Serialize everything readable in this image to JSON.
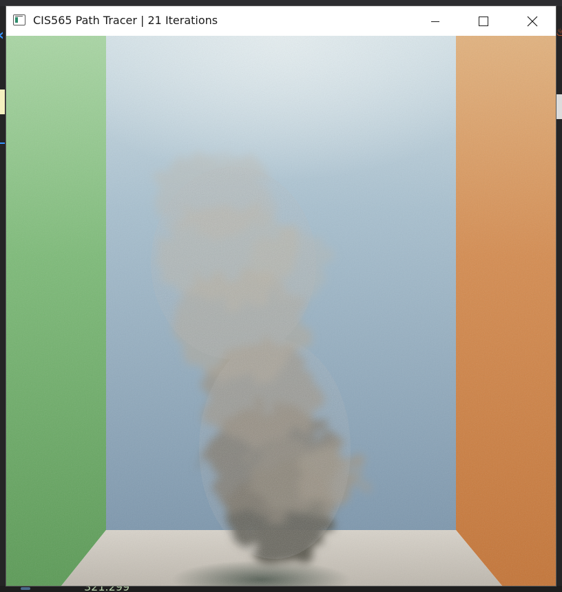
{
  "window": {
    "title": "CIS565 Path Tracer | 21 Iterations",
    "icon": "app-window-icon",
    "controls": [
      "minimize-icon",
      "maximize-icon",
      "close-icon"
    ]
  },
  "colors": {
    "left_wall": "#6aa86a",
    "right_wall": "#d68d4e",
    "back_wall": "#8fb0c6",
    "floor": "#cdc8c0",
    "smoke": "#9e9486",
    "titlebar": "#ffffff"
  },
  "background_editor": {
    "bottom_text": "321.299"
  }
}
